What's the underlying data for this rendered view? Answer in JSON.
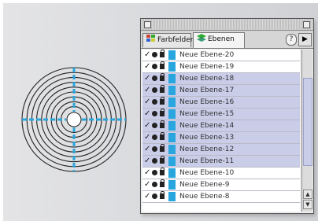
{
  "palette": {
    "tabs": [
      {
        "label": "Farbfelder",
        "active": false
      },
      {
        "label": "Ebenen",
        "active": true
      }
    ],
    "help_label": "?",
    "menu_label": "▶",
    "layers": [
      {
        "name": "Neue Ebene-20",
        "selected": false
      },
      {
        "name": "Neue Ebene-19",
        "selected": false
      },
      {
        "name": "Neue Ebene-18",
        "selected": true
      },
      {
        "name": "Neue Ebene-17",
        "selected": true
      },
      {
        "name": "Neue Ebene-16",
        "selected": true
      },
      {
        "name": "Neue Ebene-15",
        "selected": true
      },
      {
        "name": "Neue Ebene-14",
        "selected": true
      },
      {
        "name": "Neue Ebene-13",
        "selected": true
      },
      {
        "name": "Neue Ebene-12",
        "selected": true
      },
      {
        "name": "Neue Ebene-11",
        "selected": true
      },
      {
        "name": "Neue Ebene-10",
        "selected": false
      },
      {
        "name": "Neue Ebene-9",
        "selected": false
      },
      {
        "name": "Neue Ebene-8",
        "selected": false
      }
    ],
    "layer_color": "#29a6dd",
    "selection_color": "#c9cde8"
  },
  "target": {
    "ring_count": 9,
    "stroke_color": "#222222",
    "crosshair_color": "#29a6dd"
  }
}
